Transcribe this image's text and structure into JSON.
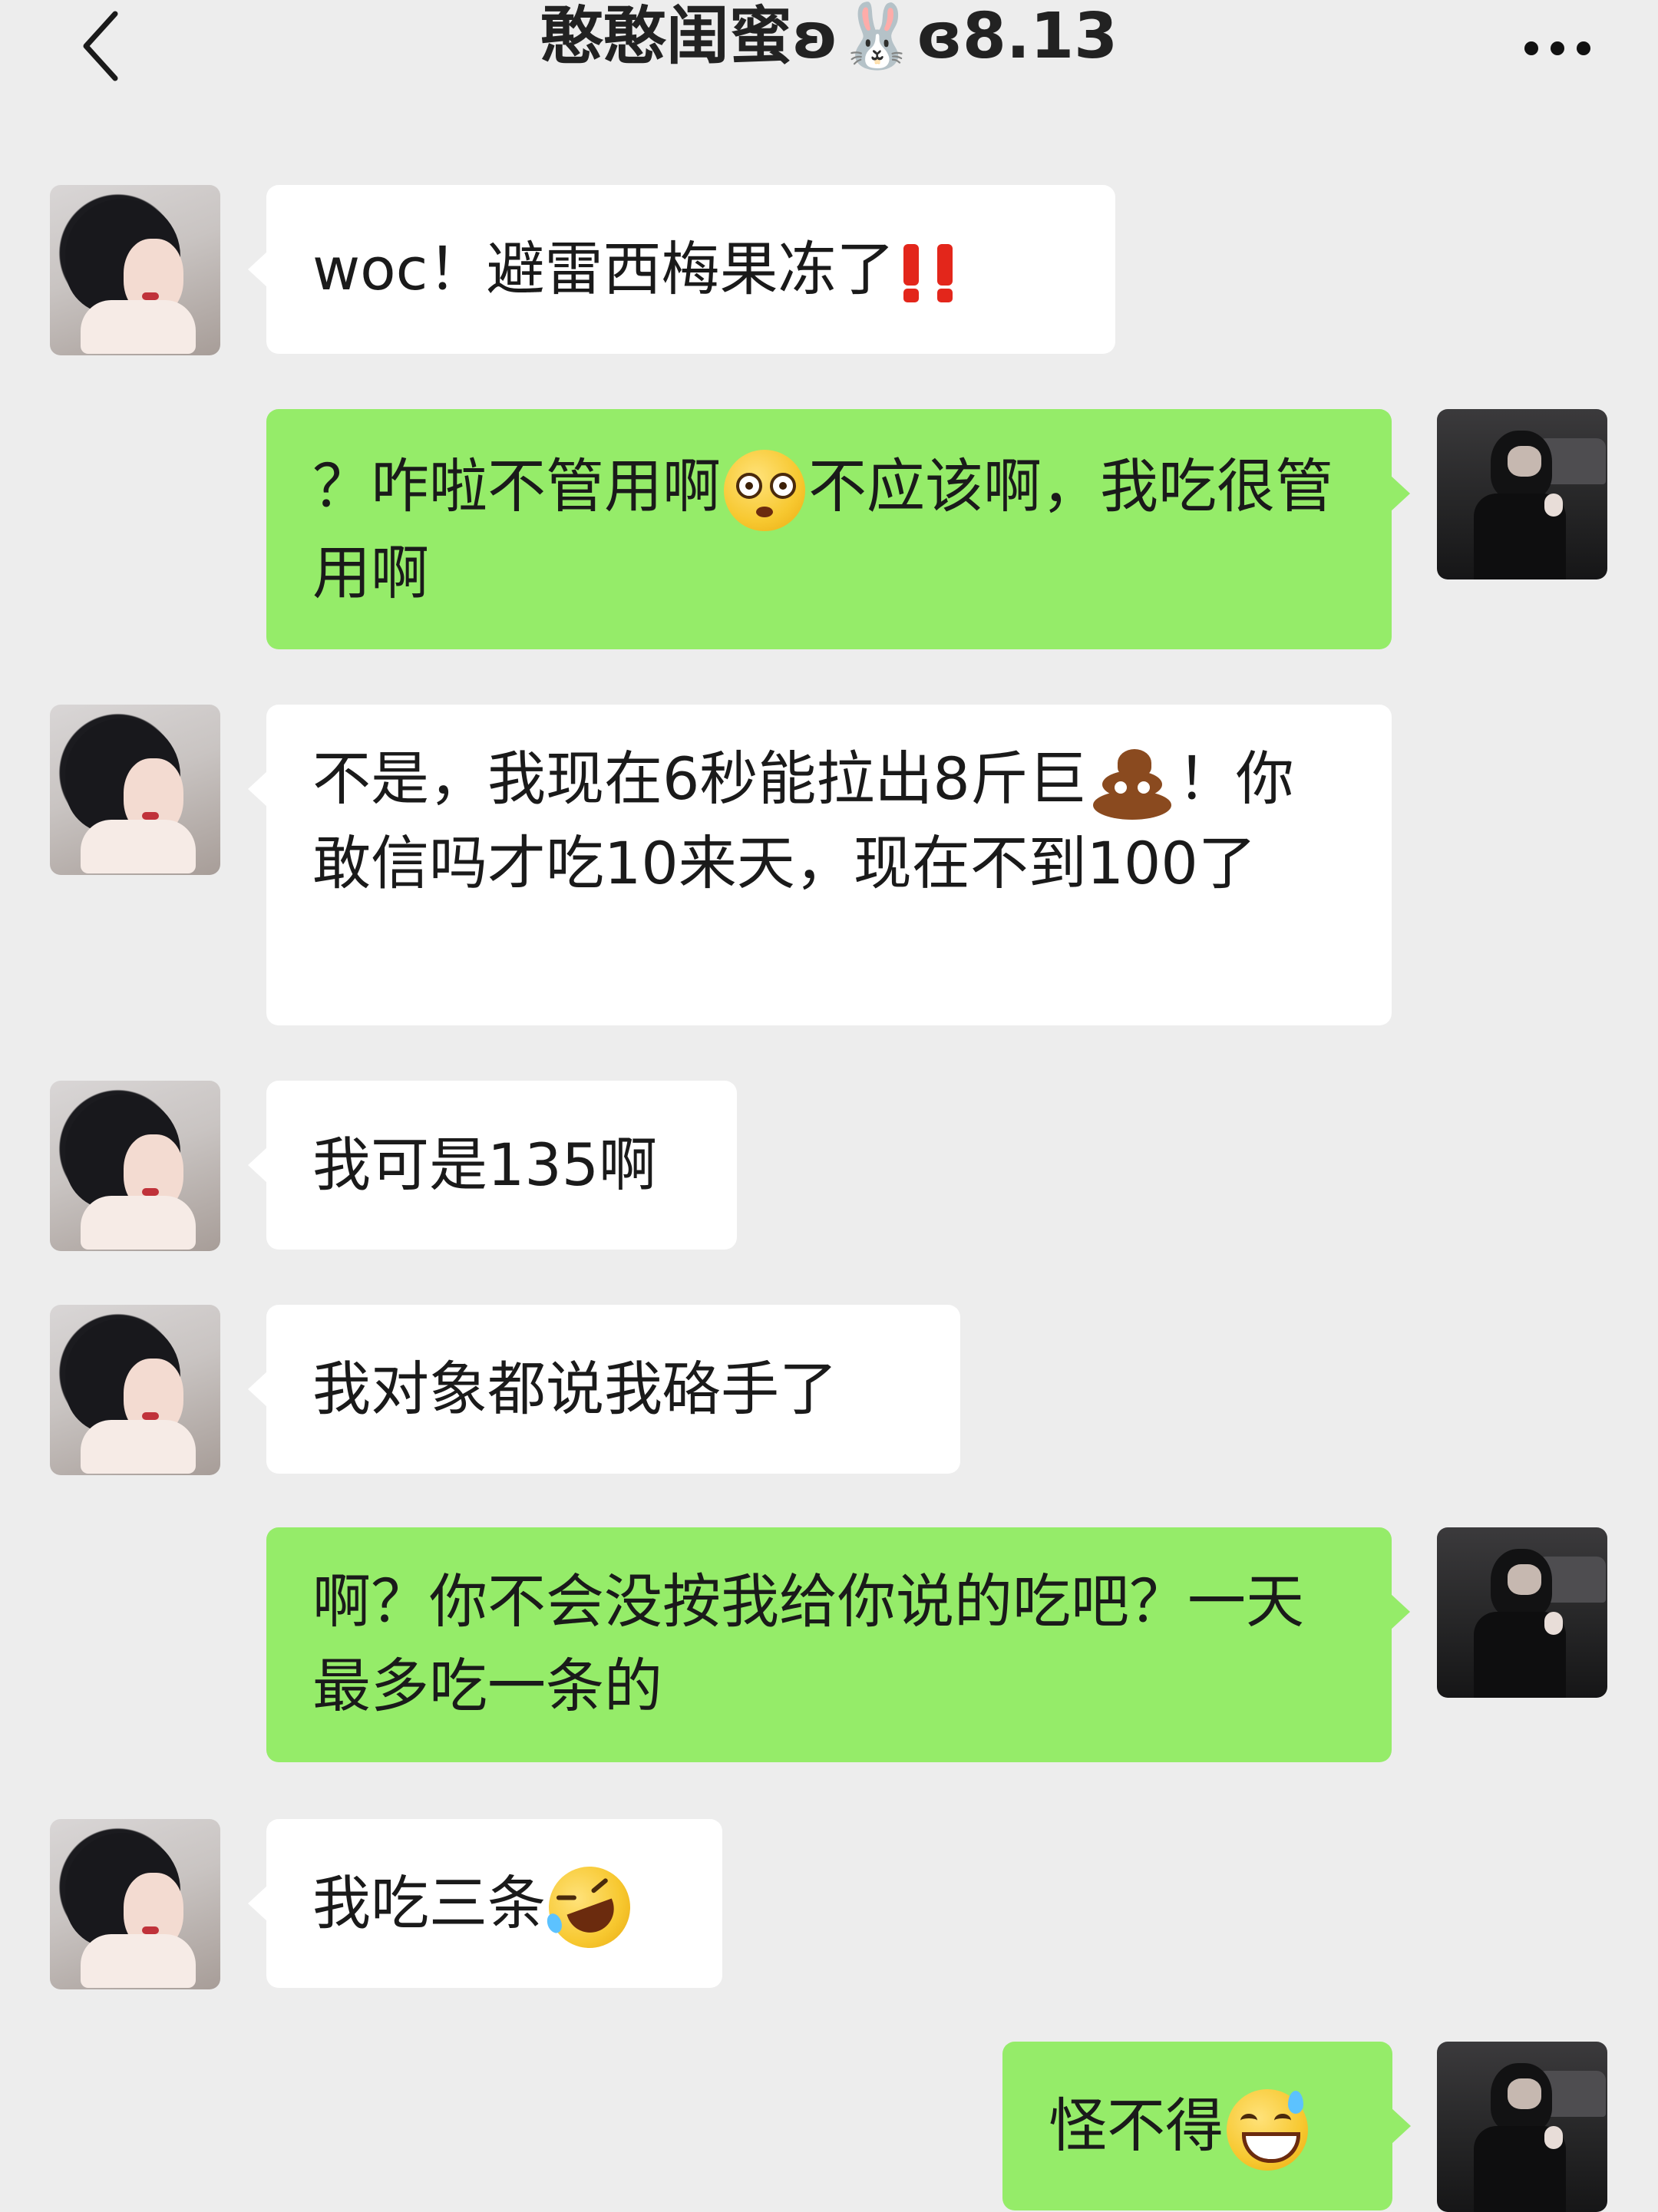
{
  "header": {
    "title": "憨憨闺蜜ʚ🐰ɞ8.13",
    "back_icon": "chevron-left-icon",
    "more_icon": "ellipsis-icon"
  },
  "messages": [
    {
      "side": "left",
      "text": "woc！避雷西梅果冻了",
      "emoji": "double-exclamation-red"
    },
    {
      "side": "right",
      "text_before": "？咋啦不管用啊",
      "emoji": "flushed-face",
      "text_after": "不应该啊，我吃很管用啊"
    },
    {
      "side": "left",
      "text_before": "不是，我现在6秒能拉出8斤巨",
      "emoji": "pile-of-poo",
      "text_after": "！你敢信吗才吃10来天，现在不到100了"
    },
    {
      "side": "left",
      "text": "我可是135啊"
    },
    {
      "side": "left",
      "text": "我对象都说我硌手了"
    },
    {
      "side": "right",
      "text": "啊？你不会没按我给你说的吃吧？一天最多吃一条的"
    },
    {
      "side": "left",
      "text": "我吃三条",
      "emoji": "rolling-on-floor-laughing"
    },
    {
      "side": "right",
      "text": "怪不得",
      "emoji": "grinning-sweat"
    }
  ],
  "colors": {
    "background": "#ededed",
    "bubble_self": "#95ec69",
    "bubble_other": "#ffffff"
  }
}
